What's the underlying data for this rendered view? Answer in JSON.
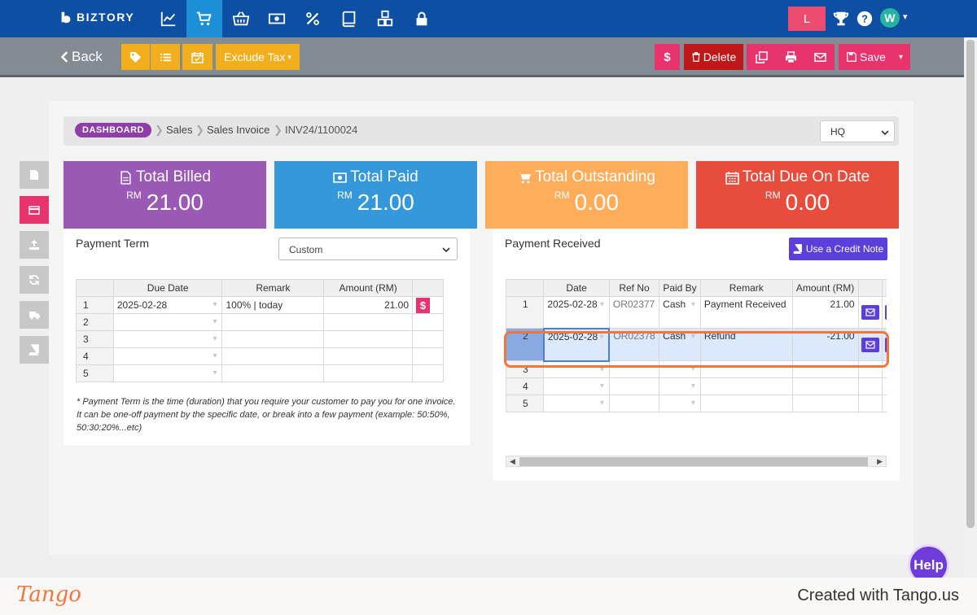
{
  "nav": {
    "brand": "BIZTORY",
    "icons": [
      "chart-line-icon",
      "shopping-cart-icon",
      "basket-icon",
      "money-icon",
      "percent-icon",
      "book-icon",
      "cubes-icon",
      "lock-icon"
    ],
    "user_initial": "L",
    "avatar": "W"
  },
  "toolbar": {
    "back": "Back",
    "exclude_tax": "Exclude Tax",
    "delete": "Delete",
    "save": "Save"
  },
  "breadcrumb": {
    "dashboard": "DASHBOARD",
    "sales": "Sales",
    "sales_invoice": "Sales Invoice",
    "invoice_no": "INV24/1100024",
    "branch": "HQ"
  },
  "summary": [
    {
      "title": "Total Billed",
      "currency": "RM",
      "value": "21.00",
      "color": "#9b59b6"
    },
    {
      "title": "Total Paid",
      "currency": "RM",
      "value": "21.00",
      "color": "#3498db"
    },
    {
      "title": "Total Outstanding",
      "currency": "RM",
      "value": "0.00",
      "color": "#ffad5a"
    },
    {
      "title": "Total Due On Date",
      "currency": "RM",
      "value": "0.00",
      "color": "#e74c3c"
    }
  ],
  "payment_term": {
    "title": "Payment Term",
    "mode": "Custom",
    "headers": [
      "Due Date",
      "Remark",
      "Amount (RM)"
    ],
    "rows": [
      {
        "n": "1",
        "date": "2025-02-28",
        "remark": "100% |  today",
        "amount": "21.00"
      },
      {
        "n": "2",
        "date": "",
        "remark": "",
        "amount": ""
      },
      {
        "n": "3",
        "date": "",
        "remark": "",
        "amount": ""
      },
      {
        "n": "4",
        "date": "",
        "remark": "",
        "amount": ""
      },
      {
        "n": "5",
        "date": "",
        "remark": "",
        "amount": ""
      }
    ],
    "note": "* Payment Term is the time (duration) that you require your customer to pay you for one invoice. It can be one-off payment by the specific date, or break into a few payment (example: 50:50%, 50:30:20%...etc)"
  },
  "payment_received": {
    "title": "Payment Received",
    "credit_note": "Use a Credit Note",
    "headers": [
      "Date",
      "Ref No",
      "Paid By",
      "Remark",
      "Amount (RM)"
    ],
    "rows": [
      {
        "n": "1",
        "date": "2025-02-28",
        "ref": "OR02377",
        "by": "Cash",
        "remark": "Payment Received",
        "amount": "21.00"
      },
      {
        "n": "2",
        "date": "2025-02-28",
        "ref": "OR02378",
        "by": "Cash",
        "remark": "Refund",
        "amount": "-21.00"
      },
      {
        "n": "3",
        "date": "",
        "ref": "",
        "by": "",
        "remark": "",
        "amount": ""
      },
      {
        "n": "4",
        "date": "",
        "ref": "",
        "by": "",
        "remark": "",
        "amount": ""
      },
      {
        "n": "5",
        "date": "",
        "ref": "",
        "by": "",
        "remark": "",
        "amount": ""
      }
    ]
  },
  "help": "Help",
  "footer": {
    "logo": "Tango",
    "credit": "Created with Tango.us"
  }
}
